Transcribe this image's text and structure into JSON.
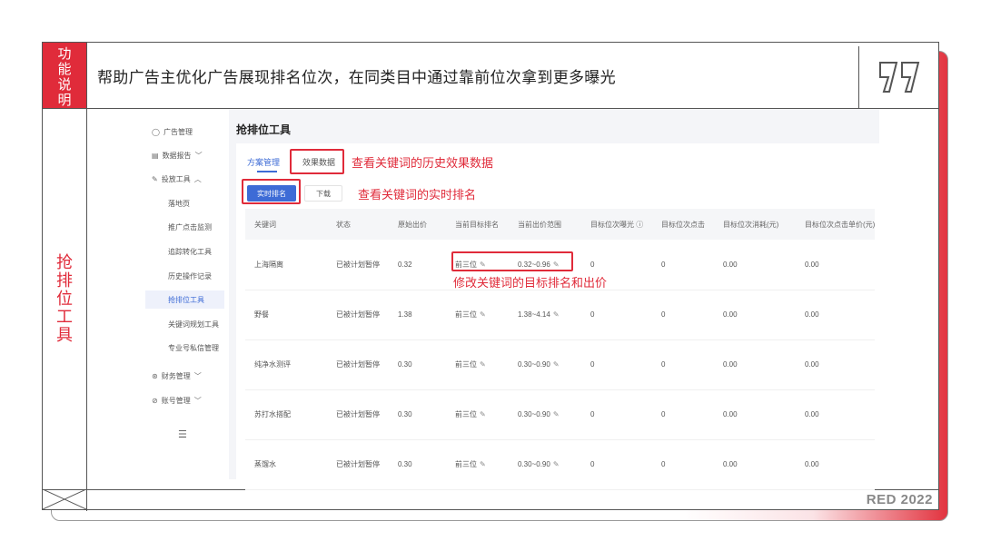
{
  "slide": {
    "label_top": [
      "功",
      "能",
      "说",
      "明"
    ],
    "title": "帮助广告主优化广告展现排名位次，在同类目中通过靠前位次拿到更多曝光",
    "side_label": [
      "抢",
      "排",
      "位",
      "工",
      "具"
    ],
    "watermark": "RED 2022",
    "accent_color": "#e02b3a"
  },
  "sidebar": {
    "items": [
      {
        "icon": "circle-icon",
        "label": "广告管理"
      },
      {
        "icon": "report-icon",
        "label": "数据报告"
      },
      {
        "icon": "tool-icon",
        "label": "投放工具"
      }
    ],
    "sub_items": [
      "落地页",
      "推广点击监测",
      "追踪转化工具",
      "历史操作记录",
      "抢排位工具",
      "关键词规划工具",
      "专业号私信管理"
    ],
    "bottom_items": [
      {
        "icon": "finance-icon",
        "label": "财务管理"
      },
      {
        "icon": "account-icon",
        "label": "账号管理"
      }
    ],
    "active": "抢排位工具"
  },
  "main": {
    "title": "抢排位工具",
    "tabs": [
      "方案管理",
      "效果数据"
    ],
    "buttons": {
      "realtime": "实时排名",
      "download": "下载"
    },
    "annotations": {
      "history": "查看关键词的历史效果数据",
      "realtime": "查看关键词的实时排名",
      "modify": "修改关键词的目标排名和出价"
    },
    "table": {
      "headers": [
        "关键词",
        "状态",
        "原始出价",
        "当前目标排名",
        "当前出价范围",
        "目标位次曝光 ⓘ",
        "目标位次点击",
        "目标位次消耗(元)",
        "目标位次点击单价(元)"
      ],
      "rows": [
        [
          "上海隔离",
          "已被计划暂停",
          "0.32",
          "前三位",
          "0.32~0.96",
          "0",
          "0",
          "0.00",
          "0.00"
        ],
        [
          "野餐",
          "已被计划暂停",
          "1.38",
          "前三位",
          "1.38~4.14",
          "0",
          "0",
          "0.00",
          "0.00"
        ],
        [
          "纯净水测评",
          "已被计划暂停",
          "0.30",
          "前三位",
          "0.30~0.90",
          "0",
          "0",
          "0.00",
          "0.00"
        ],
        [
          "苏打水搭配",
          "已被计划暂停",
          "0.30",
          "前三位",
          "0.30~0.90",
          "0",
          "0",
          "0.00",
          "0.00"
        ],
        [
          "蒸馏水",
          "已被计划暂停",
          "0.30",
          "前三位",
          "0.30~0.90",
          "0",
          "0",
          "0.00",
          "0.00"
        ]
      ]
    }
  }
}
